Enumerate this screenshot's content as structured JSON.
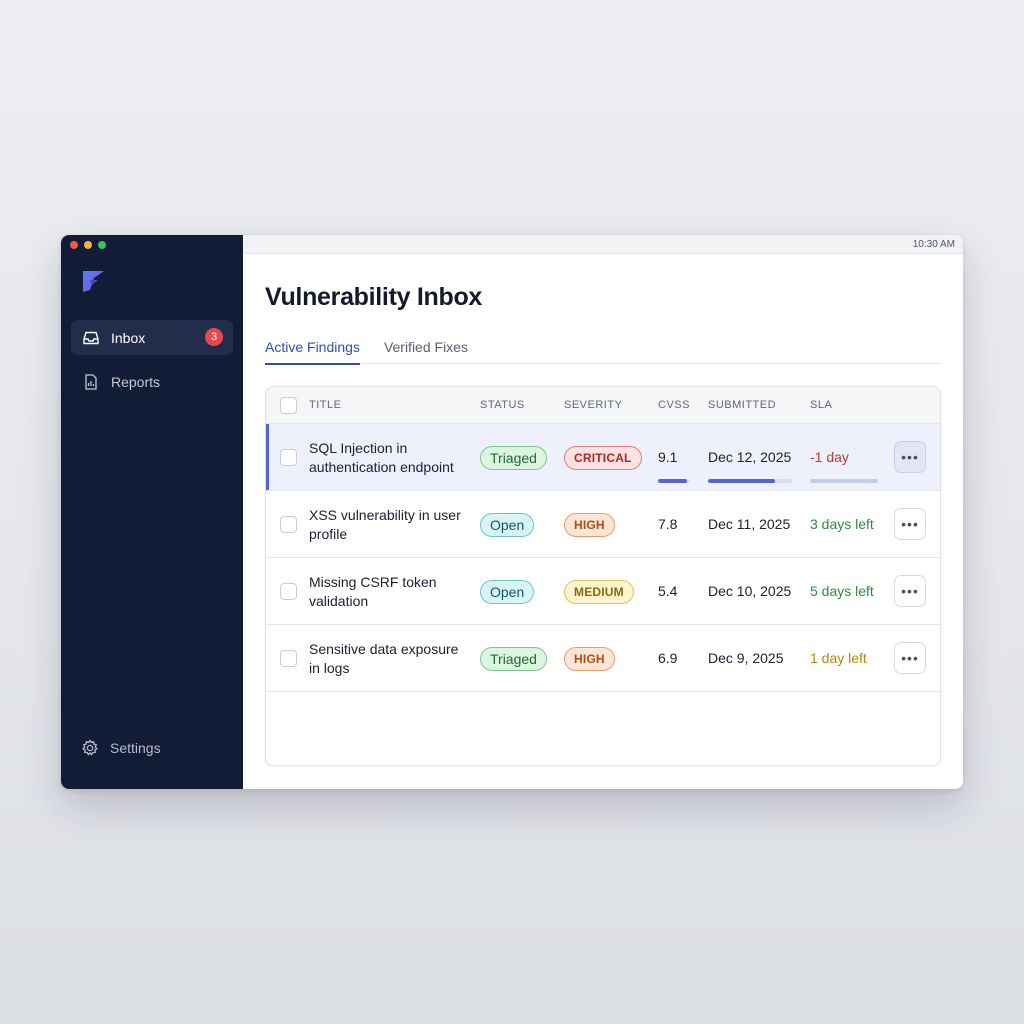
{
  "window": {
    "time": "10:30 AM"
  },
  "colors": {
    "accent": "#2f4fb8",
    "sidebar": "#121c36",
    "badge": "#e5484d"
  },
  "sidebar": {
    "logo": "brand-logo-icon",
    "items": [
      {
        "label": "Inbox",
        "icon": "inbox-icon",
        "badge": "3",
        "active": true
      },
      {
        "label": "Reports",
        "icon": "report-icon",
        "active": false
      }
    ],
    "settings_label": "Settings"
  },
  "main": {
    "title": "Vulnerability Inbox",
    "tabs": [
      {
        "label": "Active Findings",
        "active": true
      },
      {
        "label": "Verified Fixes",
        "active": false
      }
    ]
  },
  "table": {
    "columns": [
      "TITLE",
      "STATUS",
      "SEVERITY",
      "CVSS",
      "SUBMITTED",
      "SLA"
    ],
    "rows": [
      {
        "title": "SQL Injection in authentication endpoint",
        "status": "Triaged",
        "severity": "CRITICAL",
        "cvss": "9.1",
        "submitted": "Dec 12, 2025",
        "sla": "-1 day",
        "selected": true,
        "cvss_fraction": 0.91,
        "date_fraction": 0.8,
        "sla_fraction": 1.0
      },
      {
        "title": "XSS vulnerability in user profile",
        "status": "Open",
        "severity": "HIGH",
        "cvss": "7.8",
        "submitted": "Dec 11, 2025",
        "sla": "3 days left",
        "selected": false
      },
      {
        "title": "Missing CSRF token validation",
        "status": "Open",
        "severity": "MEDIUM",
        "cvss": "5.4",
        "submitted": "Dec 10, 2025",
        "sla": "5 days left",
        "selected": false
      },
      {
        "title": "Sensitive data exposure in logs",
        "status": "Triaged",
        "severity": "HIGH",
        "cvss": "6.9",
        "submitted": "Dec 9, 2025",
        "sla": "1 day left",
        "selected": false
      }
    ]
  }
}
